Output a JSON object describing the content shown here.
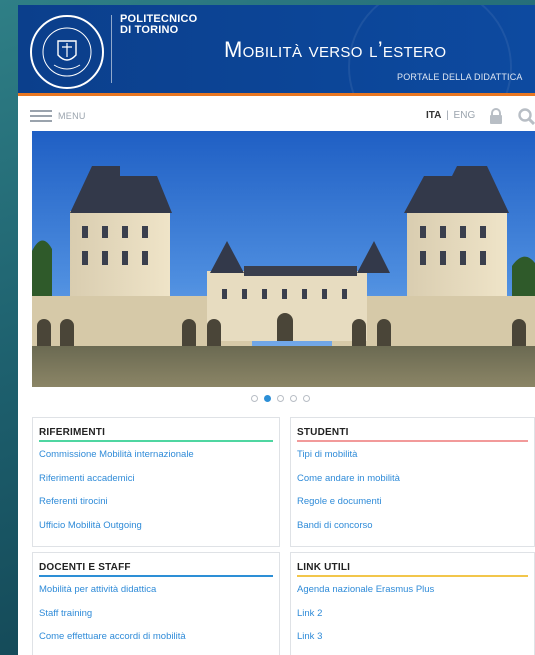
{
  "header": {
    "logo_line1": "POLITECNICO",
    "logo_line2": "DI TORINO",
    "seal_text_top": "POLITECNICO DI TORINO",
    "seal_year_left": "1859",
    "seal_year_right": "1906",
    "title": "Mobilità verso l’estero",
    "subtitle": "PORTALE DELLA DIDATTICA"
  },
  "toolbar": {
    "menu_label": "MENU",
    "lang_active": "ITA",
    "lang_separator": "|",
    "lang_other": "ENG"
  },
  "carousel": {
    "slide_count": 5,
    "active_index": 1
  },
  "colors": {
    "header_blue": "#0d4aa0",
    "header_accent": "#e87722",
    "link": "#2f8bd8",
    "riferimenti": "#4fd6a1",
    "studenti": "#f29a9a",
    "docenti": "#2d8fd6",
    "link_utili": "#f2c64b"
  },
  "panels": {
    "riferimenti": {
      "title": "RIFERIMENTI",
      "items": [
        "Commissione Mobilità internazionale",
        "Riferimenti accademici",
        "Referenti tirocini",
        "Ufficio Mobilità Outgoing"
      ]
    },
    "studenti": {
      "title": "STUDENTI",
      "items": [
        "Tipi di mobilità",
        "Come andare in mobilità",
        "Regole e documenti",
        "Bandi di concorso"
      ]
    },
    "docenti": {
      "title": "DOCENTI E STAFF",
      "items": [
        "Mobilità per attività didattica",
        "Staff training",
        "Come effettuare accordi di mobilità"
      ]
    },
    "link_utili": {
      "title": "LINK UTILI",
      "items": [
        "Agenda nazionale Erasmus Plus",
        "Link 2",
        "Link 3"
      ]
    }
  }
}
